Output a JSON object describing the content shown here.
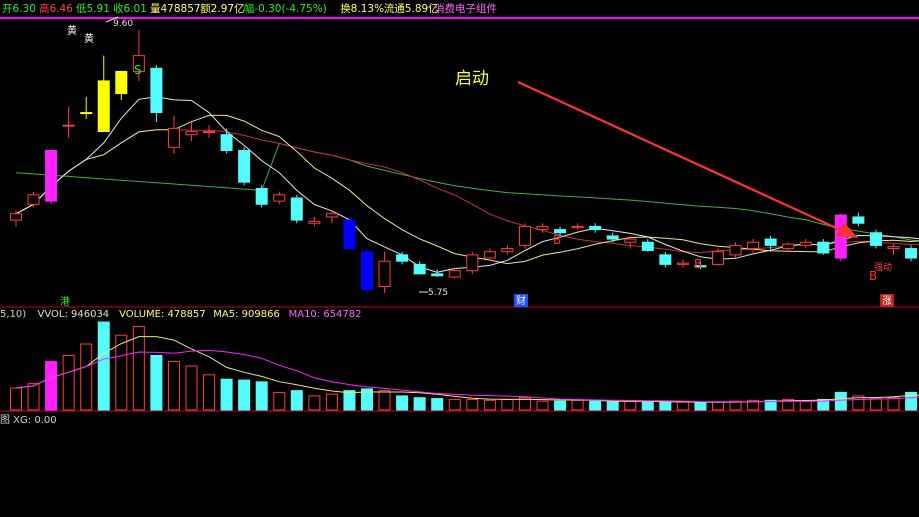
{
  "header": {
    "items": [
      {
        "text": "开6.30",
        "color": "#22ee22"
      },
      {
        "text": "高6.46",
        "color": "#ff4040"
      },
      {
        "text": "低5.91",
        "color": "#22ee22"
      },
      {
        "text": "收6.01",
        "color": "#22ee22"
      },
      {
        "text": "量478857",
        "color": "#ffff66"
      },
      {
        "text": "额2.97亿",
        "color": "#ffff66"
      },
      {
        "text": "幅-0.30(-4.75%)",
        "color": "#22ee22"
      },
      {
        "text": "换8.13%",
        "color": "#ffff66"
      },
      {
        "text": "流通5.89亿",
        "color": "#ffff66"
      },
      {
        "text": "消费电子组件",
        "color": "#ff66ff"
      }
    ]
  },
  "colors": {
    "up": "#ff3b3b",
    "down": "#54fcfc",
    "magenta": "#ff20ff",
    "yellow": "#ffff00",
    "blue": "#0000ff",
    "white": "#ffffff",
    "ma_white": "#e8e8e8",
    "ma_yellow": "#e8e880",
    "ma_red": "#c03040",
    "ma_green": "#40b040",
    "arrow": "#ff3333",
    "divider": "#c00020",
    "top_line": "#ff00ff"
  },
  "annotations": {
    "start_label": "启动",
    "high_label": "9.60",
    "low_label": "5.75",
    "huang1": "黄",
    "huang2": "黄",
    "s_mark": "S",
    "b_marks": [
      "B",
      "B",
      "B"
    ],
    "gang": "港",
    "cai": "财",
    "zhang": "涨",
    "xiangling": "强动"
  },
  "volume_legend": {
    "items": [
      {
        "text": "5,10)",
        "color": "#d0d0d0"
      },
      {
        "text": "VVOL: 946034",
        "color": "#e0e0e0"
      },
      {
        "text": "VOLUME: 478857",
        "color": "#ffff66"
      },
      {
        "text": "MA5: 909866",
        "color": "#ffff66"
      },
      {
        "text": "MA10: 654782",
        "color": "#ff66ff"
      }
    ]
  },
  "indicator_legend": {
    "items": [
      {
        "text": "图 XG: 0.00",
        "color": "#d0d0d0"
      }
    ]
  },
  "chart_data": {
    "type": "candlestick",
    "price_range": [
      5.4,
      9.7
    ],
    "candles": [
      {
        "o": 6.6,
        "h": 6.75,
        "l": 6.5,
        "c": 6.7,
        "color": "up"
      },
      {
        "o": 6.85,
        "h": 7.05,
        "l": 6.8,
        "c": 7.0,
        "color": "up"
      },
      {
        "o": 6.9,
        "h": 7.7,
        "l": 6.85,
        "c": 7.7,
        "color": "magenta"
      },
      {
        "o": 8.1,
        "h": 8.4,
        "l": 7.9,
        "c": 8.1,
        "color": "up"
      },
      {
        "o": 8.3,
        "h": 8.55,
        "l": 8.2,
        "c": 8.3,
        "color": "yellow"
      },
      {
        "o": 8.8,
        "h": 9.2,
        "l": 8.1,
        "c": 8.0,
        "color": "yellow"
      },
      {
        "o": 8.6,
        "h": 8.95,
        "l": 8.5,
        "c": 8.95,
        "color": "yellow"
      },
      {
        "o": 8.95,
        "h": 9.6,
        "l": 8.8,
        "c": 9.2,
        "color": "up"
      },
      {
        "o": 9.0,
        "h": 9.05,
        "l": 8.15,
        "c": 8.3,
        "color": "down"
      },
      {
        "o": 7.75,
        "h": 8.25,
        "l": 7.65,
        "c": 8.05,
        "color": "up"
      },
      {
        "o": 8.0,
        "h": 8.15,
        "l": 7.85,
        "c": 7.95,
        "color": "up"
      },
      {
        "o": 8.0,
        "h": 8.1,
        "l": 7.9,
        "c": 8.0,
        "color": "up"
      },
      {
        "o": 7.95,
        "h": 8.05,
        "l": 7.65,
        "c": 7.7,
        "color": "down"
      },
      {
        "o": 7.7,
        "h": 7.75,
        "l": 7.15,
        "c": 7.2,
        "color": "down"
      },
      {
        "o": 7.1,
        "h": 7.15,
        "l": 6.8,
        "c": 6.85,
        "color": "down"
      },
      {
        "o": 6.9,
        "h": 7.05,
        "l": 6.85,
        "c": 7.0,
        "color": "up"
      },
      {
        "o": 6.95,
        "h": 7.0,
        "l": 6.55,
        "c": 6.6,
        "color": "down"
      },
      {
        "o": 6.55,
        "h": 6.65,
        "l": 6.5,
        "c": 6.58,
        "color": "up"
      },
      {
        "o": 6.65,
        "h": 6.75,
        "l": 6.55,
        "c": 6.7,
        "color": "up"
      },
      {
        "o": 6.6,
        "h": 6.65,
        "l": 6.15,
        "c": 6.15,
        "color": "blue"
      },
      {
        "o": 6.1,
        "h": 6.15,
        "l": 5.45,
        "c": 5.5,
        "color": "blue"
      },
      {
        "o": 5.55,
        "h": 6.1,
        "l": 5.45,
        "c": 5.95,
        "color": "up"
      },
      {
        "o": 6.05,
        "h": 6.1,
        "l": 5.9,
        "c": 5.95,
        "color": "down"
      },
      {
        "o": 5.9,
        "h": 5.95,
        "l": 5.75,
        "c": 5.75,
        "color": "down"
      },
      {
        "o": 5.75,
        "h": 5.82,
        "l": 5.7,
        "c": 5.72,
        "color": "down"
      },
      {
        "o": 5.7,
        "h": 5.85,
        "l": 5.68,
        "c": 5.8,
        "color": "up"
      },
      {
        "o": 5.8,
        "h": 6.1,
        "l": 5.75,
        "c": 6.05,
        "color": "up"
      },
      {
        "o": 6.0,
        "h": 6.15,
        "l": 5.95,
        "c": 6.1,
        "color": "up"
      },
      {
        "o": 6.1,
        "h": 6.2,
        "l": 6.05,
        "c": 6.15,
        "color": "up"
      },
      {
        "o": 6.2,
        "h": 6.55,
        "l": 6.15,
        "c": 6.5,
        "color": "up"
      },
      {
        "o": 6.45,
        "h": 6.55,
        "l": 6.4,
        "c": 6.5,
        "color": "up"
      },
      {
        "o": 6.45,
        "h": 6.5,
        "l": 6.35,
        "c": 6.4,
        "color": "down"
      },
      {
        "o": 6.48,
        "h": 6.55,
        "l": 6.45,
        "c": 6.5,
        "color": "up"
      },
      {
        "o": 6.5,
        "h": 6.55,
        "l": 6.4,
        "c": 6.45,
        "color": "down"
      },
      {
        "o": 6.35,
        "h": 6.4,
        "l": 6.25,
        "c": 6.3,
        "color": "down"
      },
      {
        "o": 6.25,
        "h": 6.35,
        "l": 6.15,
        "c": 6.3,
        "color": "up"
      },
      {
        "o": 6.25,
        "h": 6.3,
        "l": 6.1,
        "c": 6.12,
        "color": "down"
      },
      {
        "o": 6.05,
        "h": 6.1,
        "l": 5.85,
        "c": 5.9,
        "color": "down"
      },
      {
        "o": 5.9,
        "h": 5.98,
        "l": 5.85,
        "c": 5.92,
        "color": "up"
      },
      {
        "o": 5.88,
        "h": 5.95,
        "l": 5.82,
        "c": 5.86,
        "color": "down"
      },
      {
        "o": 5.9,
        "h": 6.15,
        "l": 5.88,
        "c": 6.1,
        "color": "up"
      },
      {
        "o": 6.05,
        "h": 6.25,
        "l": 6.0,
        "c": 6.2,
        "color": "up"
      },
      {
        "o": 6.15,
        "h": 6.3,
        "l": 6.05,
        "c": 6.25,
        "color": "up"
      },
      {
        "o": 6.3,
        "h": 6.35,
        "l": 6.1,
        "c": 6.2,
        "color": "down"
      },
      {
        "o": 6.15,
        "h": 6.25,
        "l": 6.1,
        "c": 6.22,
        "color": "up"
      },
      {
        "o": 6.2,
        "h": 6.3,
        "l": 6.15,
        "c": 6.25,
        "color": "up"
      },
      {
        "o": 6.25,
        "h": 6.3,
        "l": 6.05,
        "c": 6.08,
        "color": "down"
      },
      {
        "o": 6.0,
        "h": 6.7,
        "l": 5.95,
        "c": 6.68,
        "color": "magenta"
      },
      {
        "o": 6.65,
        "h": 6.72,
        "l": 6.5,
        "c": 6.55,
        "color": "down"
      },
      {
        "o": 6.4,
        "h": 6.45,
        "l": 6.15,
        "c": 6.2,
        "color": "down"
      },
      {
        "o": 6.15,
        "h": 6.22,
        "l": 6.05,
        "c": 6.18,
        "color": "up"
      },
      {
        "o": 6.15,
        "h": 6.2,
        "l": 5.95,
        "c": 6.0,
        "color": "down"
      },
      {
        "o": 6.05,
        "h": 6.55,
        "l": 6.0,
        "c": 6.5,
        "color": "white"
      },
      {
        "o": 6.5,
        "h": 6.55,
        "l": 6.48,
        "c": 6.52,
        "color": "up"
      },
      {
        "o": 6.8,
        "h": 7.25,
        "l": 6.75,
        "c": 7.2,
        "color": "magenta"
      },
      {
        "o": 7.0,
        "h": 7.8,
        "l": 7.0,
        "c": 7.4,
        "color": "down"
      }
    ],
    "volumes": [
      {
        "v": 0.25,
        "color": "up"
      },
      {
        "v": 0.3,
        "color": "up"
      },
      {
        "v": 0.55,
        "color": "magenta"
      },
      {
        "v": 0.62,
        "color": "up"
      },
      {
        "v": 0.75,
        "color": "up"
      },
      {
        "v": 1.0,
        "color": "down"
      },
      {
        "v": 0.85,
        "color": "up"
      },
      {
        "v": 0.95,
        "color": "up"
      },
      {
        "v": 0.62,
        "color": "down"
      },
      {
        "v": 0.55,
        "color": "up"
      },
      {
        "v": 0.5,
        "color": "up"
      },
      {
        "v": 0.4,
        "color": "up"
      },
      {
        "v": 0.35,
        "color": "down"
      },
      {
        "v": 0.34,
        "color": "down"
      },
      {
        "v": 0.32,
        "color": "down"
      },
      {
        "v": 0.2,
        "color": "up"
      },
      {
        "v": 0.22,
        "color": "down"
      },
      {
        "v": 0.16,
        "color": "up"
      },
      {
        "v": 0.18,
        "color": "up"
      },
      {
        "v": 0.22,
        "color": "down"
      },
      {
        "v": 0.24,
        "color": "down"
      },
      {
        "v": 0.22,
        "color": "up"
      },
      {
        "v": 0.16,
        "color": "down"
      },
      {
        "v": 0.14,
        "color": "down"
      },
      {
        "v": 0.13,
        "color": "down"
      },
      {
        "v": 0.12,
        "color": "up"
      },
      {
        "v": 0.12,
        "color": "up"
      },
      {
        "v": 0.11,
        "color": "up"
      },
      {
        "v": 0.12,
        "color": "up"
      },
      {
        "v": 0.14,
        "color": "up"
      },
      {
        "v": 0.1,
        "color": "up"
      },
      {
        "v": 0.1,
        "color": "down"
      },
      {
        "v": 0.11,
        "color": "up"
      },
      {
        "v": 0.1,
        "color": "down"
      },
      {
        "v": 0.09,
        "color": "down"
      },
      {
        "v": 0.1,
        "color": "up"
      },
      {
        "v": 0.09,
        "color": "down"
      },
      {
        "v": 0.09,
        "color": "down"
      },
      {
        "v": 0.09,
        "color": "up"
      },
      {
        "v": 0.08,
        "color": "down"
      },
      {
        "v": 0.09,
        "color": "up"
      },
      {
        "v": 0.1,
        "color": "up"
      },
      {
        "v": 0.11,
        "color": "up"
      },
      {
        "v": 0.11,
        "color": "down"
      },
      {
        "v": 0.12,
        "color": "up"
      },
      {
        "v": 0.1,
        "color": "up"
      },
      {
        "v": 0.12,
        "color": "down"
      },
      {
        "v": 0.2,
        "color": "down"
      },
      {
        "v": 0.16,
        "color": "up"
      },
      {
        "v": 0.13,
        "color": "up"
      },
      {
        "v": 0.14,
        "color": "up"
      },
      {
        "v": 0.2,
        "color": "down"
      },
      {
        "v": 0.24,
        "color": "white"
      },
      {
        "v": 0.3,
        "color": "up"
      },
      {
        "v": 0.55,
        "color": "up"
      },
      {
        "v": 0.95,
        "color": "down"
      }
    ],
    "xg_signal": {
      "peak_index": 53,
      "value": 0.0
    }
  }
}
